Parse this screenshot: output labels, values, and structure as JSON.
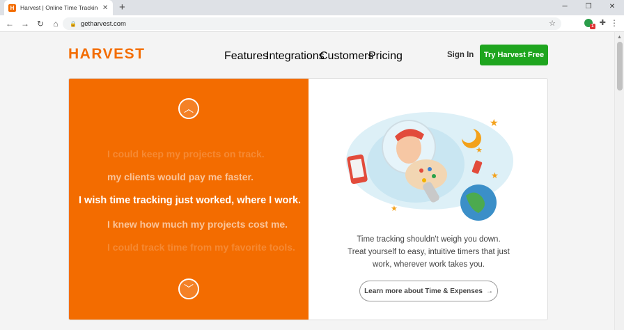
{
  "browser": {
    "tab_title": "Harvest | Online Time Tracking a",
    "favicon_letter": "H",
    "url": "getharvest.com"
  },
  "header": {
    "logo": "HARVEST",
    "nav": [
      "Features",
      "Integrations",
      "Customers",
      "Pricing"
    ],
    "sign_in": "Sign In",
    "cta": "Try Harvest Free"
  },
  "hero": {
    "phrases": [
      "I could keep my projects on track.",
      "my clients would pay me faster.",
      "I wish time tracking just worked, where I work.",
      "I knew how much my projects cost me.",
      "I could track time from my favorite tools."
    ],
    "description": [
      "Time tracking shouldn't weigh you down.",
      "Treat yourself to easy, intuitive timers that just",
      "work, wherever work takes you."
    ],
    "learn_more": "Learn more about Time & Expenses"
  },
  "colors": {
    "brand": "#f36c00",
    "cta": "#1ea51e"
  }
}
